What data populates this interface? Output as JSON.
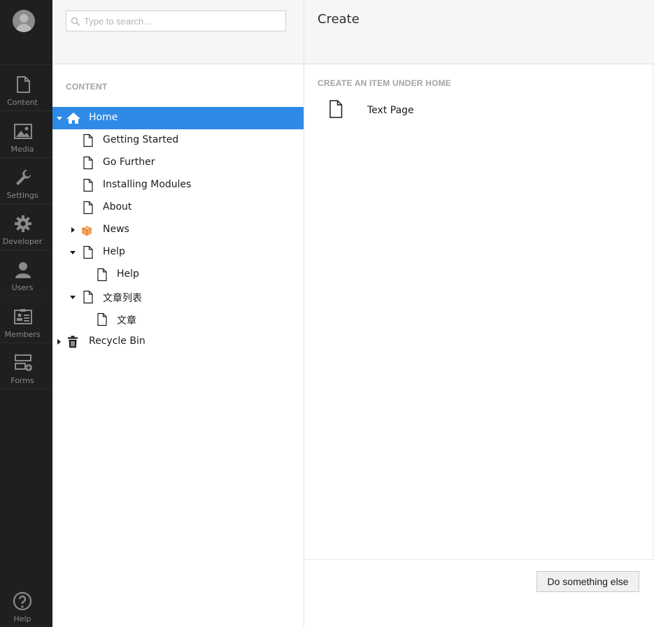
{
  "rail": {
    "items": [
      {
        "label": "Content",
        "icon": "document-icon"
      },
      {
        "label": "Media",
        "icon": "image-icon"
      },
      {
        "label": "Settings",
        "icon": "wrench-icon"
      },
      {
        "label": "Developer",
        "icon": "gear-icon"
      },
      {
        "label": "Users",
        "icon": "user-icon"
      },
      {
        "label": "Members",
        "icon": "id-card-icon"
      },
      {
        "label": "Forms",
        "icon": "forms-icon"
      }
    ],
    "help_label": "Help"
  },
  "tree": {
    "search_placeholder": "Type to search...",
    "section_label": "CONTENT",
    "nodes": [
      {
        "label": "Home",
        "icon": "home-icon",
        "expanded": true,
        "selected": true
      },
      {
        "label": "Getting Started",
        "icon": "document-icon"
      },
      {
        "label": "Go Further",
        "icon": "document-icon"
      },
      {
        "label": "Installing Modules",
        "icon": "document-icon"
      },
      {
        "label": "About",
        "icon": "document-icon"
      },
      {
        "label": "News",
        "icon": "package-icon",
        "expanded": false
      },
      {
        "label": "Help",
        "icon": "document-icon",
        "expanded": true
      },
      {
        "label": "Help",
        "icon": "document-icon"
      },
      {
        "label": "文章列表",
        "icon": "document-icon",
        "expanded": true
      },
      {
        "label": "文章",
        "icon": "document-icon"
      },
      {
        "label": "Recycle Bin",
        "icon": "trash-icon",
        "expanded": false
      }
    ]
  },
  "main": {
    "title": "Create",
    "subtitle": "CREATE AN ITEM UNDER HOME",
    "items": [
      {
        "label": "Text Page",
        "icon": "document-icon"
      }
    ],
    "footer_button": "Do something else"
  },
  "colors": {
    "rail_bg": "#1f1f1f",
    "selected_bg": "#2e8ae6",
    "package_orange": "#e8893a"
  }
}
